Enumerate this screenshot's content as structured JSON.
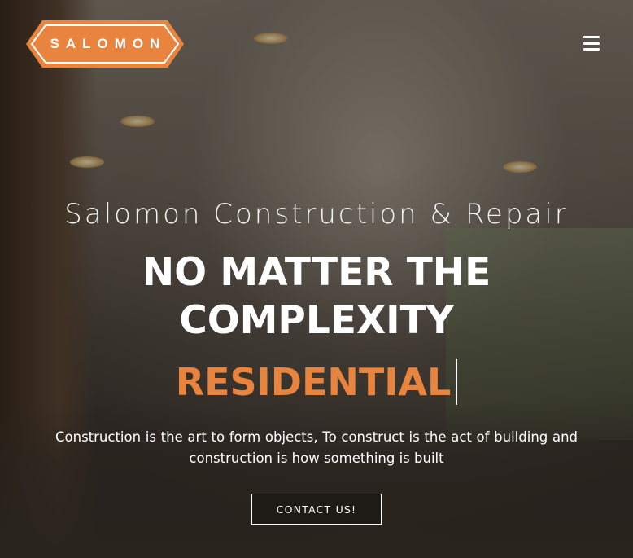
{
  "brand": {
    "logo_text": "SALOMON",
    "accent_color": "#e8843d"
  },
  "nav": {
    "menu_icon": "hamburger-menu-icon"
  },
  "hero": {
    "site_name": "Salomon Construction & Repair",
    "headline": "NO MATTER THE COMPLEXITY",
    "typed_word": "RESIDENTIAL",
    "tagline": "Construction is the art to form objects, To construct is the act of building and construction is how something is built",
    "cta_label": "CONTACT US!"
  }
}
